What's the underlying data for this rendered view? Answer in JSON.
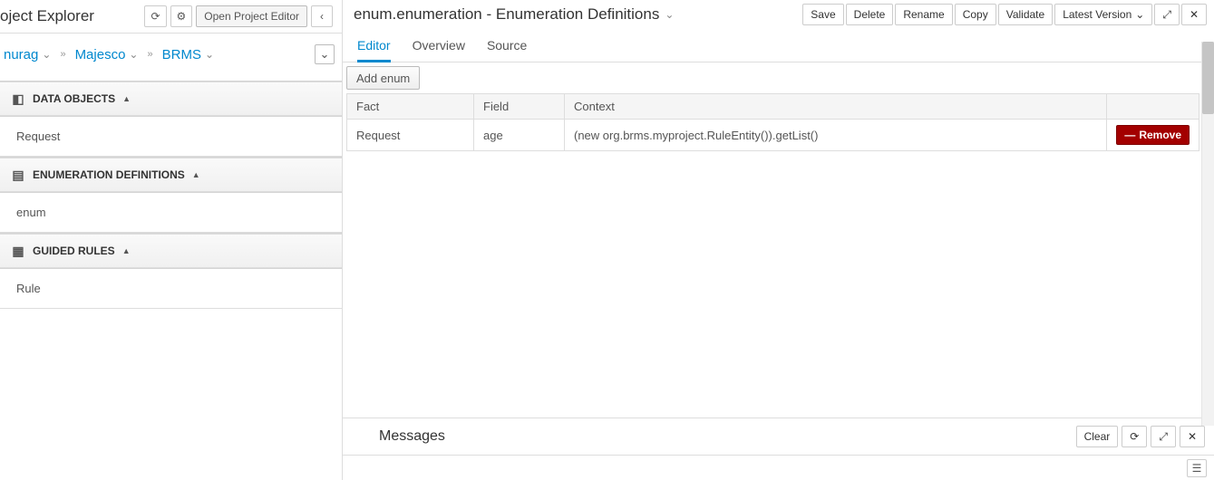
{
  "sidebar": {
    "title": "oject Explorer",
    "open_editor_label": "Open Project Editor",
    "breadcrumb": [
      "nurag",
      "Majesco",
      "BRMS"
    ],
    "sections": [
      {
        "title": "DATA OBJECTS",
        "items": [
          "Request"
        ]
      },
      {
        "title": "ENUMERATION DEFINITIONS",
        "items": [
          "enum"
        ]
      },
      {
        "title": "GUIDED RULES",
        "items": [
          "Rule"
        ]
      }
    ]
  },
  "main": {
    "title": "enum.enumeration - Enumeration Definitions",
    "actions": {
      "save": "Save",
      "delete": "Delete",
      "rename": "Rename",
      "copy": "Copy",
      "validate": "Validate",
      "latest": "Latest Version"
    },
    "tabs": [
      "Editor",
      "Overview",
      "Source"
    ],
    "active_tab": 0,
    "add_enum_label": "Add enum",
    "table": {
      "headers": [
        "Fact",
        "Field",
        "Context"
      ],
      "rows": [
        {
          "fact": "Request",
          "field": "age",
          "context": "(new org.brms.myproject.RuleEntity()).getList()"
        }
      ]
    },
    "remove_label": "Remove"
  },
  "messages": {
    "title": "Messages",
    "clear": "Clear"
  }
}
